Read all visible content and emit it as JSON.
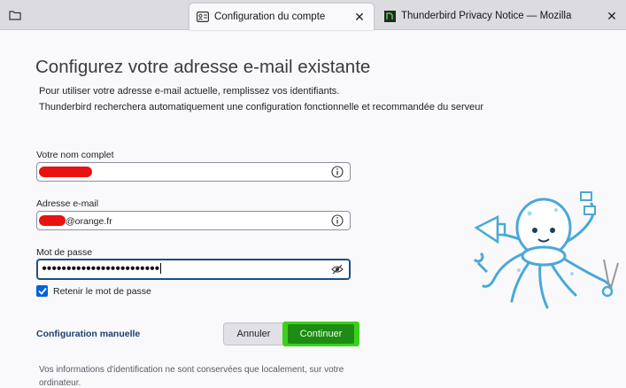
{
  "tabs": [
    {
      "label": "Configuration du compte",
      "icon": "account-settings-icon",
      "active": true
    },
    {
      "label": "Thunderbird Privacy Notice — Mozilla",
      "icon": "privacy-notice-favicon",
      "active": false
    }
  ],
  "page": {
    "title": "Configurez votre adresse e-mail existante",
    "description_line1": "Pour utiliser votre adresse e-mail actuelle, remplissez vos identifiants.",
    "description_line2": "Thunderbird recherchera automatiquement une configuration fonctionnelle et recommandée du serveur"
  },
  "form": {
    "name_label": "Votre nom complet",
    "name_value": "",
    "email_label": "Adresse e-mail",
    "email_value": "@orange.fr",
    "password_label": "Mot de passe",
    "password_value": "●●●●●●●●●●●●●●●●●●●●●●●●",
    "remember_label": "Retenir le mot de passe",
    "remember_checked": true
  },
  "actions": {
    "manual_config": "Configuration manuelle",
    "cancel": "Annuler",
    "continue": "Continuer"
  },
  "footer": {
    "line1": "Vos informations d'identification ne sont conservées que localement, sur votre",
    "line2": "ordinateur."
  },
  "colors": {
    "accent": "#0060df",
    "link": "#1a3f6e",
    "continue_highlight": "#3bd11b",
    "redaction": "#e81212",
    "mascot": "#4aa8d8"
  }
}
